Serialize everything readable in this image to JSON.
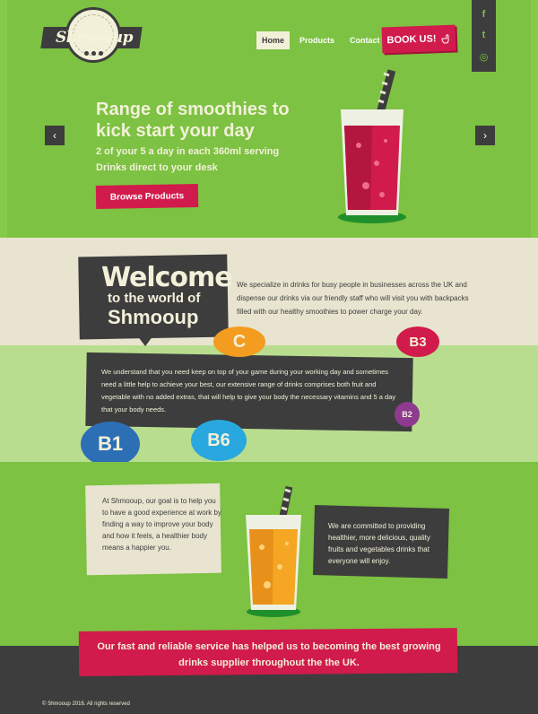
{
  "brand": {
    "logo_text": "Shmooup"
  },
  "nav": {
    "items": [
      {
        "label": "Home",
        "active": true
      },
      {
        "label": "Products",
        "active": false
      },
      {
        "label": "Contact Us",
        "active": false
      }
    ],
    "book_label": "BOOK US!"
  },
  "social": {
    "icons": [
      "facebook-icon",
      "twitter-icon",
      "instagram-icon"
    ],
    "facebook": "f",
    "twitter": "t",
    "instagram": "◎"
  },
  "hero": {
    "title": "Range of smoothies to kick start your day",
    "subtitle": "2 of your 5 a day in each 360ml serving Drinks direct to your desk",
    "cta": "Browse Products",
    "prev": "‹",
    "next": "›"
  },
  "welcome": {
    "title": "Welcome",
    "subtitle": "to the world of",
    "name": "Shmooup",
    "intro": "We specialize in drinks for busy people in businesses across the UK and dispense our drinks via our friendly staff who will visit you with backpacks filled with our healthy smoothies to power charge your day.",
    "panel": "We understand that you need keep on top of your game during your working day and sometimes need a little help to achieve your best, our extensive range of drinks comprises both fruit and vegetable with no added extras, that will help to give your body the necessary vitamins and 5 a day that your body needs."
  },
  "vitamins": {
    "c": "C",
    "b3": "B3",
    "b2": "B2",
    "b1": "B1",
    "b6": "B6"
  },
  "about": {
    "left": "At Shmooup, our goal is to help you to have a good experience at work by finding a way to improve your body and how it feels, a healthier body means a happier you.",
    "right": "We are committed to providing healthier, more delicious, quality fruits and vegetables drinks that everyone will enjoy."
  },
  "footer": {
    "message": "Our fast and reliable service has helped us to becoming the best growing drinks supplier throughout the the UK.",
    "copyright": "© Shmooup 2016. All rights reserved"
  },
  "colors": {
    "green": "#7dc242",
    "dark": "#3d3d3d",
    "cream": "#e8e4cf",
    "red": "#d11b4c",
    "orange": "#f39c1f",
    "purple": "#8e3a8f",
    "blue": "#2d6fb5",
    "cyan": "#29a8df"
  }
}
